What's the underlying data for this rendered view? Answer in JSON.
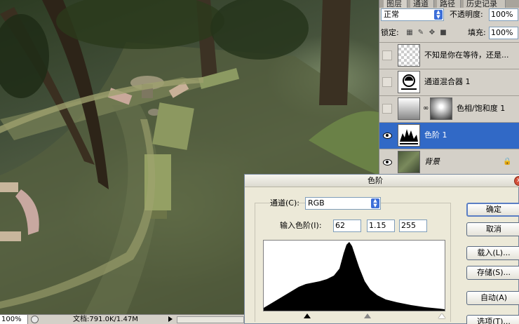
{
  "layers_panel": {
    "tabs": [
      "图层",
      "通道",
      "路径",
      "历史记录"
    ],
    "blend_mode": "正常",
    "opacity_label": "不透明度:",
    "opacity_value": "100%",
    "lock_label": "锁定:",
    "fill_label": "填充:",
    "fill_value": "100%",
    "layers": [
      {
        "name": "不知是你在等待，还是...",
        "visible": false,
        "selected": false
      },
      {
        "name": "通道混合器 1",
        "visible": false,
        "selected": false
      },
      {
        "name": "色相/饱和度 1",
        "visible": false,
        "selected": false
      },
      {
        "name": "色阶 1",
        "visible": true,
        "selected": true
      },
      {
        "name": "背景",
        "visible": true,
        "selected": false,
        "locked": true
      }
    ]
  },
  "levels_dialog": {
    "title": "色阶",
    "channel_label": "通道(C):",
    "channel_value": "RGB",
    "input_label": "输入色阶(I):",
    "input_black": "62",
    "input_gamma": "1.15",
    "input_white": "255",
    "buttons": {
      "ok": "确定",
      "cancel": "取消",
      "load": "载入(L)...",
      "save": "存储(S)...",
      "auto": "自动(A)",
      "options": "选项(T)..."
    }
  },
  "status_bar": {
    "zoom": "100%",
    "doc_info": "文档:791.0K/1.47M"
  }
}
